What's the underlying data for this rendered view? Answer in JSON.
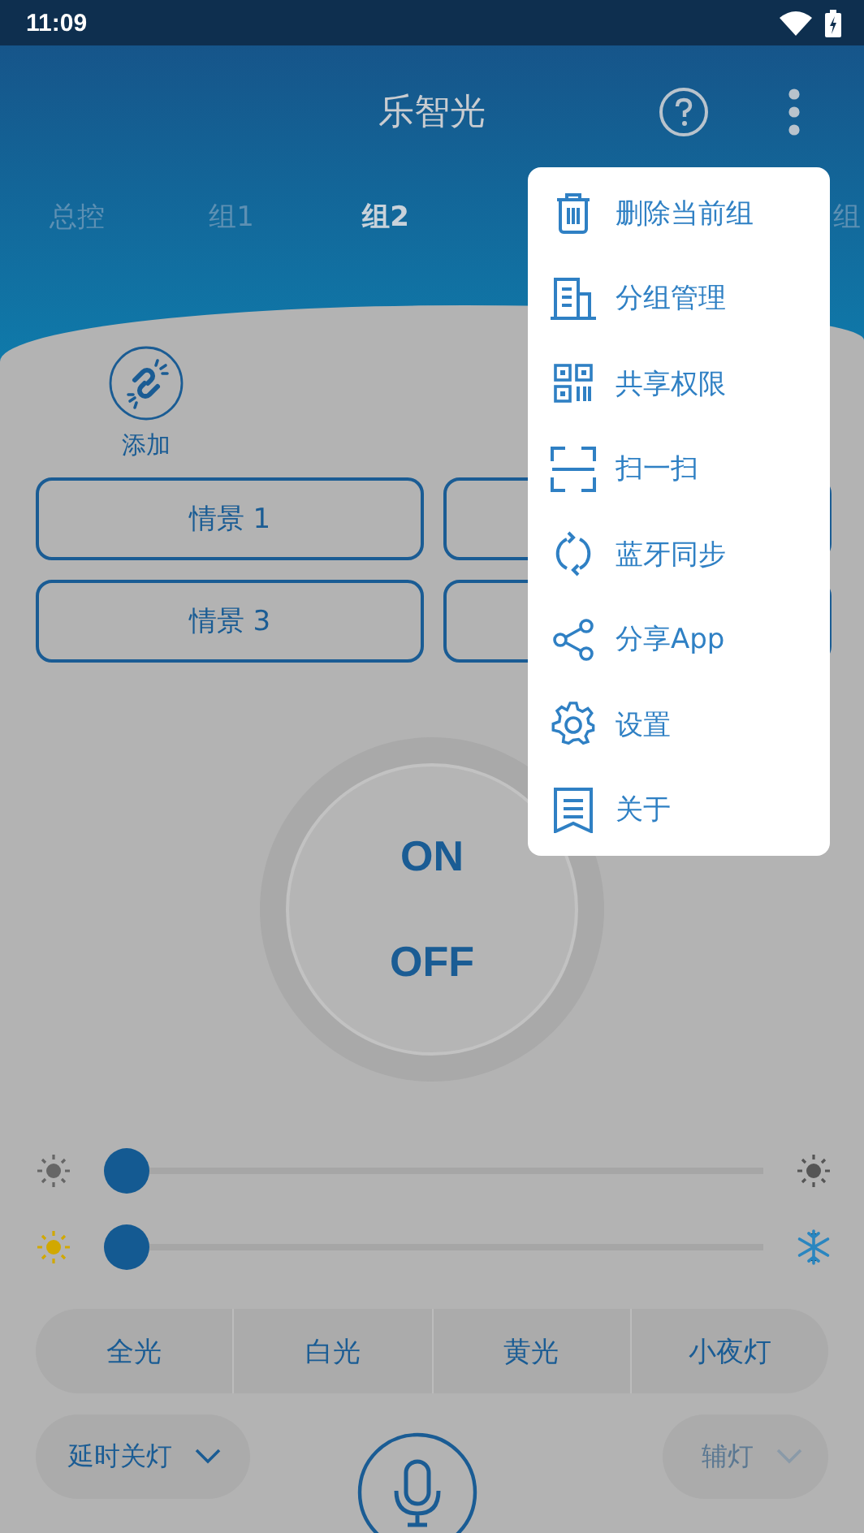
{
  "status_bar": {
    "time": "11:09"
  },
  "header": {
    "title": "乐智光"
  },
  "tabs": [
    {
      "label": "总控",
      "selected": false
    },
    {
      "label": "组1",
      "selected": false
    },
    {
      "label": "组2",
      "selected": true
    },
    {
      "label": "组",
      "selected": false
    }
  ],
  "add": {
    "label": "添加"
  },
  "scenes": [
    {
      "kind": "label",
      "label": "情景 1"
    },
    {
      "kind": "covered"
    },
    {
      "kind": "label",
      "label": "情景 3"
    },
    {
      "kind": "covered"
    }
  ],
  "power": {
    "on": "ON",
    "off": "OFF"
  },
  "sliders": [
    {
      "kind": "brightness",
      "level": 0
    },
    {
      "kind": "temperature",
      "level": 0
    }
  ],
  "modes": [
    {
      "label": "全光"
    },
    {
      "label": "白光"
    },
    {
      "label": "黄光"
    },
    {
      "label": "小夜灯"
    }
  ],
  "bottom": {
    "timer": "延时关灯",
    "aux": "辅灯"
  },
  "menu": [
    {
      "kind": "trash",
      "label": "删除当前组"
    },
    {
      "kind": "building",
      "label": "分组管理"
    },
    {
      "kind": "qr",
      "label": "共享权限"
    },
    {
      "kind": "scan",
      "label": "扫一扫"
    },
    {
      "kind": "sync",
      "label": "蓝牙同步"
    },
    {
      "kind": "share",
      "label": "分享App"
    },
    {
      "kind": "gear",
      "label": "设置"
    },
    {
      "kind": "doc",
      "label": "关于"
    }
  ]
}
